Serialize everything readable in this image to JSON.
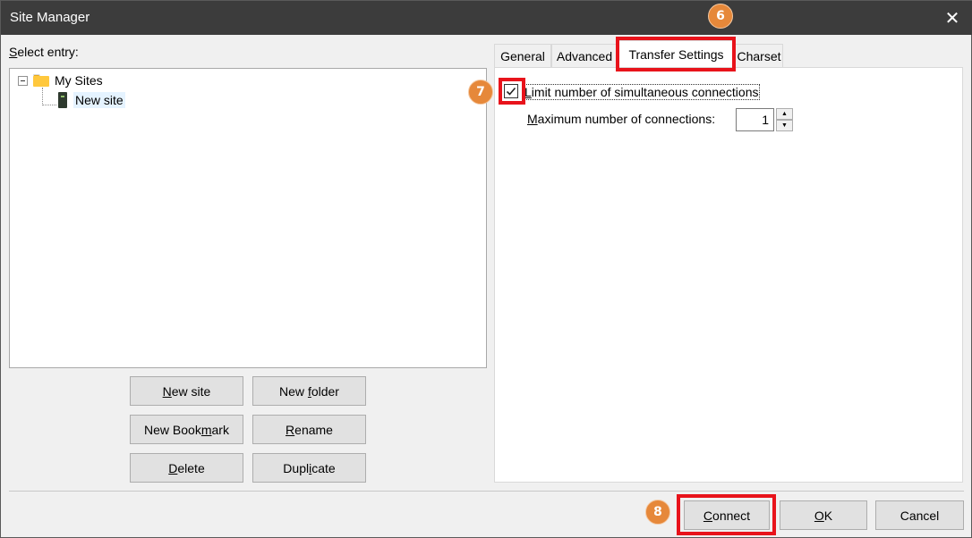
{
  "window": {
    "title": "Site Manager",
    "close_glyph": "✕"
  },
  "left": {
    "select_entry_prefix": "S",
    "select_entry_rest": "elect entry:",
    "tree": [
      {
        "label": "My Sites",
        "icon": "folder-icon"
      },
      {
        "label": "New site",
        "icon": "server-icon"
      }
    ]
  },
  "buttons": {
    "new_site": {
      "pre": "",
      "u": "N",
      "post": "ew site"
    },
    "new_folder": {
      "pre": "New ",
      "u": "f",
      "post": "older"
    },
    "new_bookmark": {
      "pre": "New Book",
      "u": "m",
      "post": "ark"
    },
    "rename": {
      "pre": "",
      "u": "R",
      "post": "ename"
    },
    "delete": {
      "pre": "",
      "u": "D",
      "post": "elete"
    },
    "duplicate": {
      "pre": "Dupl",
      "u": "i",
      "post": "cate"
    }
  },
  "tabs": [
    {
      "label": "General"
    },
    {
      "label": "Advanced"
    },
    {
      "label": "Transfer Settings"
    },
    {
      "label": "Charset"
    }
  ],
  "transfer": {
    "limit_prefix": "L",
    "limit_rest": "imit number of simultaneous connections",
    "limit_checked": true,
    "max_prefix": "M",
    "max_rest": "aximum number of connections:",
    "max_value": "1"
  },
  "footer": {
    "connect": {
      "u": "C",
      "post": "onnect"
    },
    "ok": {
      "u": "O",
      "post": "K"
    },
    "cancel": "Cancel"
  },
  "annotations": {
    "step6": "6",
    "step7": "7",
    "step8": "8",
    "highlight_color": "#e8131b",
    "badge_color": "#e6883a"
  }
}
